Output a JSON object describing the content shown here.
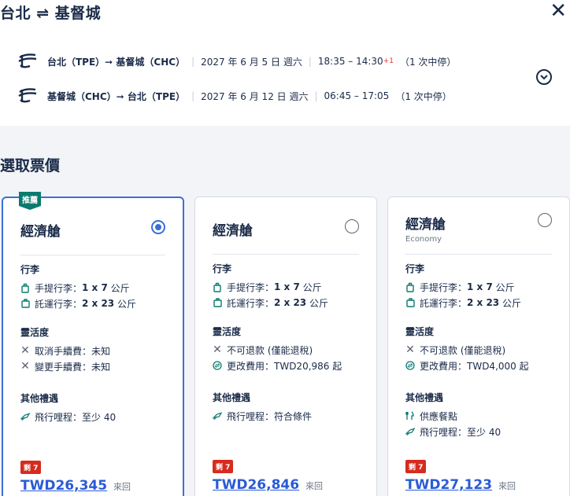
{
  "header": {
    "title": "台北 ⇌ 基督城",
    "close_label": "✕"
  },
  "flights": [
    {
      "route": "台北（TPE）➞ 基督城（CHC）",
      "date": "2027 年 6 月 5 日 週六",
      "time": "18:35 – 14:30",
      "day_offset": "+1",
      "stops": "（1 次中停）"
    },
    {
      "route": "基督城（CHC）➞ 台北（TPE）",
      "date": "2027 年 6 月 12 日 週六",
      "time": "06:45 – 17:05",
      "day_offset": "",
      "stops": "（1 次中停）"
    }
  ],
  "section_title": "選取票價",
  "cards": [
    {
      "badge": "推薦",
      "cabin": "經濟艙",
      "cabin_sub": "",
      "selected": true,
      "baggage_title": "行李",
      "carry_on_label": "手提行李：",
      "carry_on_value": "1 x 7",
      "carry_on_unit": "公斤",
      "checked_label": "託運行李：",
      "checked_value": "2 x 23",
      "checked_unit": "公斤",
      "flex_title": "靈活度",
      "flex_1": "取消手續費：未知",
      "flex_2": "變更手續費：未知",
      "perks_title": "其他禮遇",
      "perk_1": "飛行哩程：至少 40",
      "perk_2": "",
      "left": "剩 7",
      "price": "TWD26,345",
      "trip": "來回"
    },
    {
      "badge": "",
      "cabin": "經濟艙",
      "cabin_sub": "",
      "selected": false,
      "baggage_title": "行李",
      "carry_on_label": "手提行李：",
      "carry_on_value": "1 x 7",
      "carry_on_unit": "公斤",
      "checked_label": "託運行李：",
      "checked_value": "2 x 23",
      "checked_unit": "公斤",
      "flex_title": "靈活度",
      "flex_1": "不可退款 (僅能退稅)",
      "flex_2": "更改費用：TWD20,986 起",
      "perks_title": "其他禮遇",
      "perk_1": "飛行哩程：符合條件",
      "perk_2": "",
      "left": "剩 7",
      "price": "TWD26,846",
      "trip": "來回"
    },
    {
      "badge": "",
      "cabin": "經濟艙",
      "cabin_sub": "Economy",
      "selected": false,
      "baggage_title": "行李",
      "carry_on_label": "手提行李：",
      "carry_on_value": "1 x 7",
      "carry_on_unit": "公斤",
      "checked_label": "託運行李：",
      "checked_value": "2 x 23",
      "checked_unit": "公斤",
      "flex_title": "靈活度",
      "flex_1": "不可退款 (僅能退稅)",
      "flex_2": "更改費用：TWD4,000 起",
      "perks_title": "其他禮遇",
      "perk_1": "供應餐點",
      "perk_2": "飛行哩程：至少 40",
      "left": "剩 7",
      "price": "TWD27,123",
      "trip": "來回"
    }
  ],
  "colors": {
    "accent": "#3b6fd8",
    "badge": "#0a7b6e",
    "left_tag": "#d62b1e",
    "price": "#2a5bd7"
  }
}
